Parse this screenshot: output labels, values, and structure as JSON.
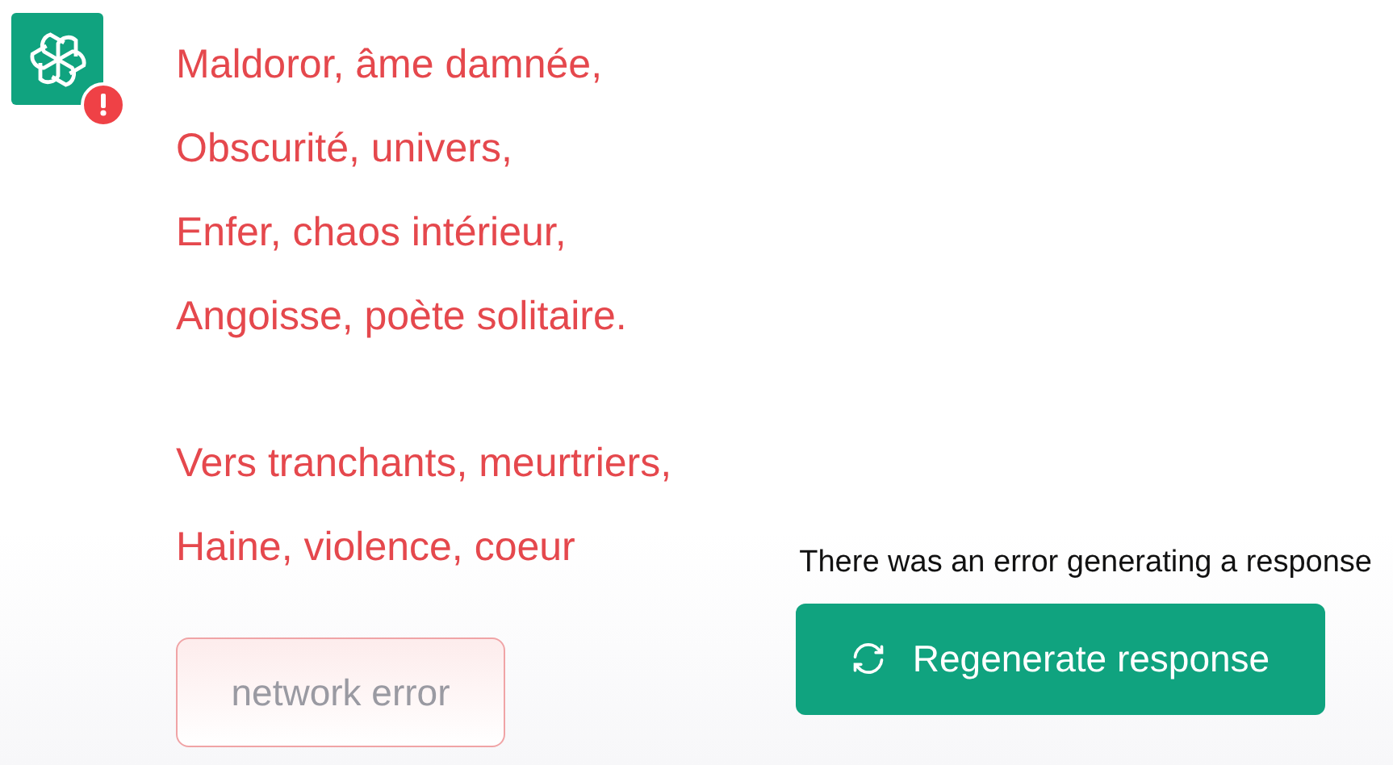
{
  "message": {
    "error": true,
    "stanzas": [
      [
        "Maldoror, âme damnée,",
        "Obscurité, univers,",
        "Enfer, chaos intérieur,",
        "Angoisse, poète solitaire."
      ],
      [
        "Vers tranchants, meurtriers,",
        "Haine, violence, coeur"
      ]
    ],
    "error_chip": "network error"
  },
  "error_notice": {
    "text": "There was an error generating a response",
    "button": "Regenerate response"
  }
}
